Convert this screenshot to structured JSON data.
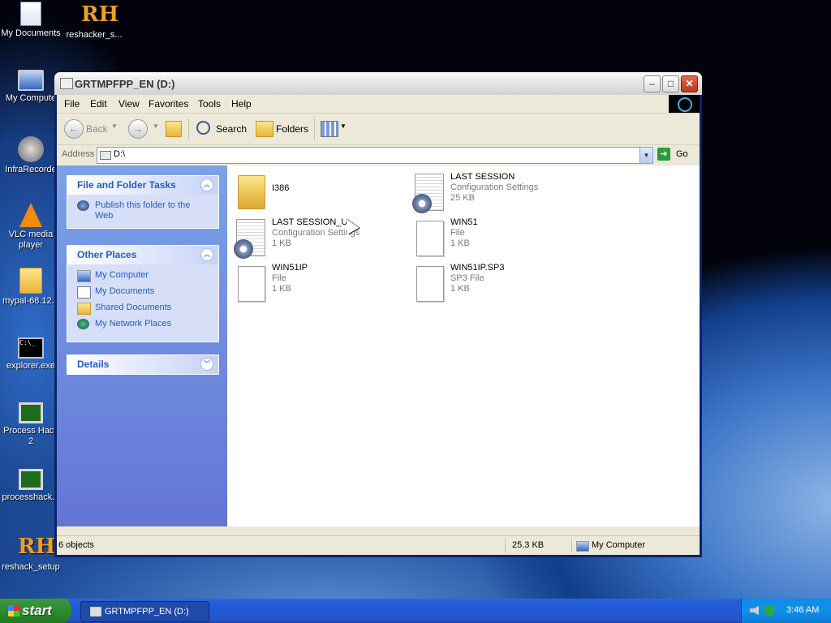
{
  "desktop": {
    "icons": [
      {
        "label": "My Documents",
        "icon": "my-documents-icon"
      },
      {
        "label": "reshacker_s...",
        "icon": "reshacker-icon"
      },
      {
        "label": "My Compute",
        "icon": "my-computer-icon"
      },
      {
        "label": "InfraRecorde",
        "icon": "infrarecorder-icon"
      },
      {
        "label": "VLC media player",
        "icon": "vlc-icon"
      },
      {
        "label": "mypal-68.12...",
        "icon": "folder-icon"
      },
      {
        "label": "explorer.exe",
        "icon": "cmd-icon"
      },
      {
        "label": "Process Hack 2",
        "icon": "process-hacker-icon"
      },
      {
        "label": "processhack...",
        "icon": "process-hacker-icon"
      },
      {
        "label": "reshack_setup",
        "icon": "reshacker-icon"
      }
    ]
  },
  "window": {
    "title": "GRTMPFPP_EN (D:)",
    "controls": {
      "minimize": "–",
      "maximize": "□",
      "close": "✕"
    },
    "menu": [
      "File",
      "Edit",
      "View",
      "Favorites",
      "Tools",
      "Help"
    ],
    "toolbar": {
      "back": "Back",
      "search": "Search",
      "folders": "Folders"
    },
    "address": {
      "label": "Address",
      "value": "D:\\",
      "go": "Go"
    },
    "tasks": {
      "file_folder": {
        "title": "File and Folder Tasks",
        "items": [
          "Publish this folder to the Web"
        ]
      },
      "other_places": {
        "title": "Other Places",
        "items": [
          "My Computer",
          "My Documents",
          "Shared Documents",
          "My Network Places"
        ]
      },
      "details": {
        "title": "Details"
      }
    },
    "files": [
      {
        "name": "I386",
        "type": "",
        "size": "",
        "icon": "folder-icon"
      },
      {
        "name": "LAST SESSION",
        "type": "Configuration Settings",
        "size": "25 KB",
        "icon": "config-settings-icon"
      },
      {
        "name": "LAST SESSION_U",
        "type": "Configuration Settings",
        "size": "1 KB",
        "icon": "config-settings-icon"
      },
      {
        "name": "WIN51",
        "type": "File",
        "size": "1 KB",
        "icon": "file-icon"
      },
      {
        "name": "WIN51IP",
        "type": "File",
        "size": "1 KB",
        "icon": "file-icon"
      },
      {
        "name": "WIN51IP.SP3",
        "type": "SP3 File",
        "size": "1 KB",
        "icon": "file-icon"
      }
    ],
    "status": {
      "count": "6 objects",
      "size": "25.3 KB",
      "zone": "My Computer"
    }
  },
  "taskbar": {
    "start": "start",
    "task": "GRTMPFPP_EN (D:)",
    "clock": "3:46 AM"
  }
}
